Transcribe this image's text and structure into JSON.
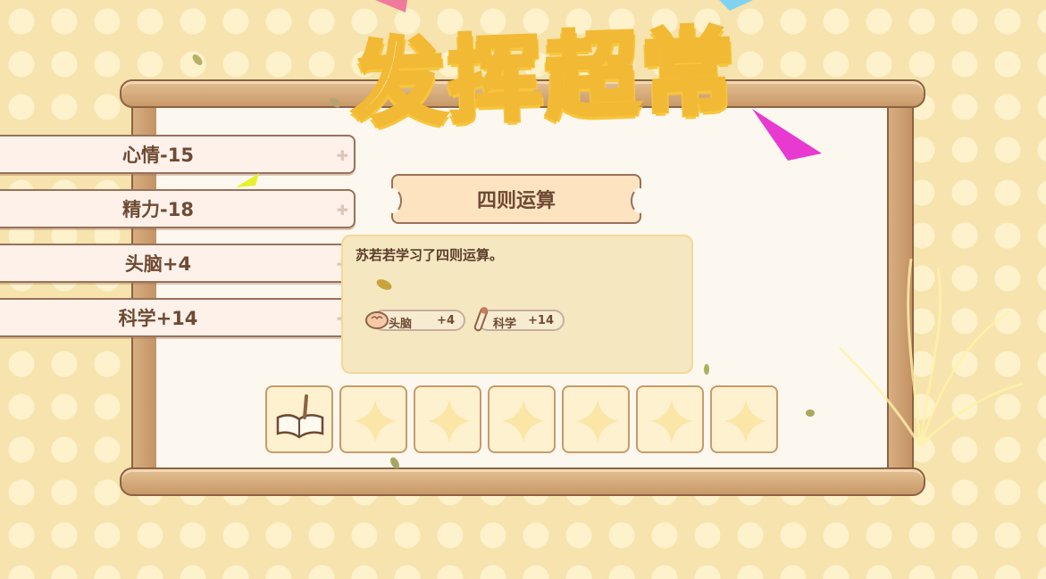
{
  "banner": {
    "title": "发挥超常"
  },
  "stats": [
    {
      "label": "心情-15"
    },
    {
      "label": "精力-18"
    },
    {
      "label": "头脑+4"
    },
    {
      "label": "科学+14"
    }
  ],
  "event": {
    "title": "四则运算",
    "description": "苏若若学习了四则运算。",
    "rewards": [
      {
        "icon": "brain-icon",
        "name": "头脑",
        "value": "+4"
      },
      {
        "icon": "test-tube-icon",
        "name": "科学",
        "value": "+14"
      }
    ]
  },
  "inventory": {
    "slots": [
      {
        "icon": "book-quill-icon",
        "filled": true
      },
      {
        "icon": "empty-slot",
        "filled": false
      },
      {
        "icon": "empty-slot",
        "filled": false
      },
      {
        "icon": "empty-slot",
        "filled": false
      },
      {
        "icon": "empty-slot",
        "filled": false
      },
      {
        "icon": "empty-slot",
        "filled": false
      },
      {
        "icon": "empty-slot",
        "filled": false
      }
    ]
  },
  "colors": {
    "background": "#f6e3ad",
    "wood": "#c99a68",
    "outline": "#9b7058",
    "title_outline": "#f2b934",
    "text": "#6e4a33"
  }
}
